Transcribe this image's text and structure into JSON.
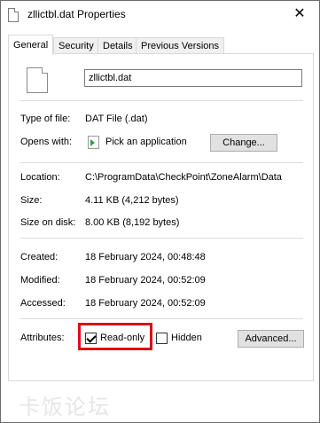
{
  "window": {
    "title": "zllictbl.dat Properties",
    "close_glyph": "✕"
  },
  "tabs": [
    {
      "label": "General",
      "active": true
    },
    {
      "label": "Security"
    },
    {
      "label": "Details"
    },
    {
      "label": "Previous Versions"
    }
  ],
  "general": {
    "file_name": "zllictbl.dat",
    "type_of_file": {
      "label": "Type of file:",
      "value": "DAT File (.dat)"
    },
    "opens_with": {
      "label": "Opens with:",
      "value": "Pick an application",
      "change_button": "Change..."
    },
    "location": {
      "label": "Location:",
      "value": "C:\\ProgramData\\CheckPoint\\ZoneAlarm\\Data"
    },
    "size": {
      "label": "Size:",
      "value": "4.11 KB (4,212 bytes)"
    },
    "size_on_disk": {
      "label": "Size on disk:",
      "value": "8.00 KB (8,192 bytes)"
    },
    "created": {
      "label": "Created:",
      "value": "18 February 2024, 00:48:48"
    },
    "modified": {
      "label": "Modified:",
      "value": "18 February 2024, 00:52:09"
    },
    "accessed": {
      "label": "Accessed:",
      "value": "18 February 2024, 00:52:09"
    },
    "attributes": {
      "label": "Attributes:",
      "read_only": {
        "label": "Read-only",
        "checked": true
      },
      "hidden": {
        "label": "Hidden",
        "checked": false
      },
      "advanced_button": "Advanced..."
    }
  },
  "highlight_color": "#e10b14",
  "watermark": "卡饭论坛"
}
